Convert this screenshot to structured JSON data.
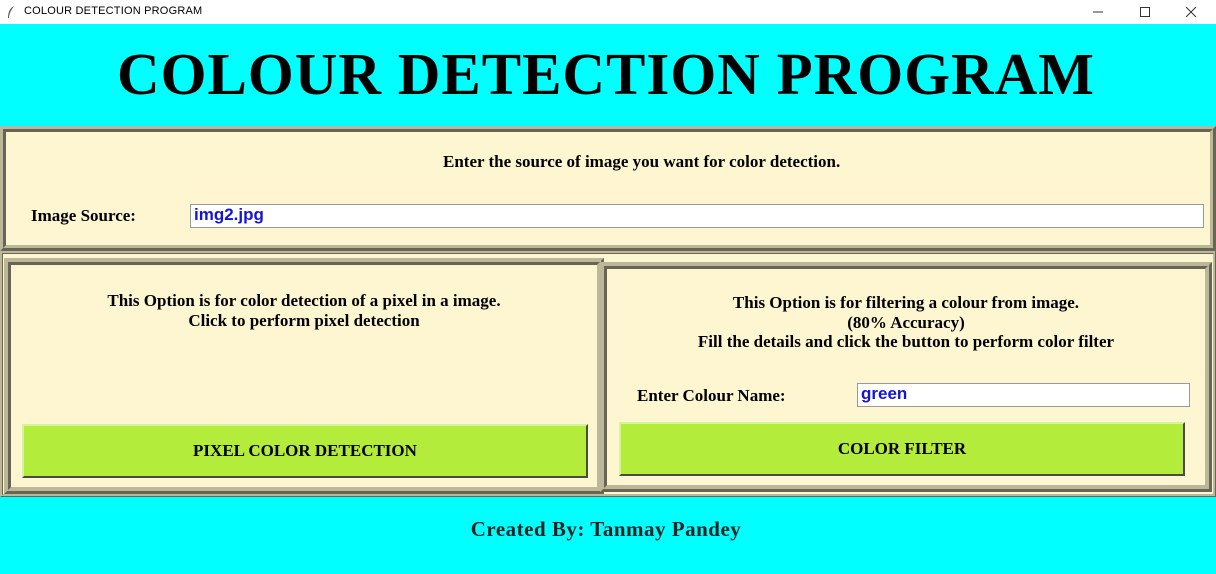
{
  "window": {
    "title": "COLOUR DETECTION PROGRAM",
    "icons": {
      "app": "feather-icon",
      "minimize": "minimize-icon",
      "maximize": "maximize-icon",
      "close": "close-icon"
    }
  },
  "header": {
    "title": "COLOUR DETECTION PROGRAM"
  },
  "source": {
    "instruction": "Enter the source of image you want for color detection.",
    "label": "Image Source:",
    "value": "img2.jpg"
  },
  "pixel_option": {
    "line1": "This Option is for color detection of a pixel in a image.",
    "line2": "Click to perform pixel detection",
    "button_label": "PIXEL COLOR DETECTION"
  },
  "filter_option": {
    "line1": "This Option is for filtering a colour from image.",
    "line2": "(80% Accuracy)",
    "line3": "Fill the details and click the button to perform color filter",
    "colour_label": "Enter Colour Name:",
    "colour_value": "green",
    "button_label": "COLOR FILTER"
  },
  "footer": {
    "credit": "Created By: Tanmay Pandey"
  },
  "colors": {
    "header_bg": "#00ffff",
    "panel_bg": "#fdf6d0",
    "button_bg": "#b4ec3c",
    "entry_text": "#1414d4"
  }
}
